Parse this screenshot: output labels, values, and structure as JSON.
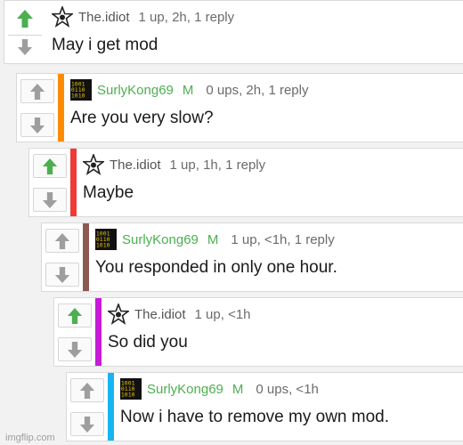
{
  "colors": {
    "upvote_active": "#4caf50",
    "vote_inactive": "#9e9e9e",
    "mod_green": "#4caf50",
    "bars": [
      "#ff8c00",
      "#ef3b36",
      "#8d5a52",
      "#c61ad8",
      "#16b5f0"
    ]
  },
  "icons": {
    "upvote": "arrow-up-icon",
    "downvote": "arrow-down-icon",
    "avatar_idiot": "star-badge-icon",
    "avatar_kong": "binary-code-icon"
  },
  "comments": [
    {
      "user": "The.idiot",
      "mod": "",
      "meta": "1 up, 2h, 1 reply",
      "text": "May i get mod",
      "upvoted": true
    },
    {
      "user": "SurlyKong69",
      "mod": "M",
      "meta": "0 ups, 2h, 1 reply",
      "text": "Are you very slow?",
      "upvoted": false
    },
    {
      "user": "The.idiot",
      "mod": "",
      "meta": "1 up, 1h, 1 reply",
      "text": "Maybe",
      "upvoted": true
    },
    {
      "user": "SurlyKong69",
      "mod": "M",
      "meta": "1 up, <1h, 1 reply",
      "text": "You responded in only one hour.",
      "upvoted": false
    },
    {
      "user": "The.idiot",
      "mod": "",
      "meta": "1 up, <1h",
      "text": "So did you",
      "upvoted": true
    },
    {
      "user": "SurlyKong69",
      "mod": "M",
      "meta": "0 ups, <1h",
      "text": "Now i have to remove my own mod.",
      "upvoted": false
    }
  ],
  "watermark": "imgflip.com"
}
